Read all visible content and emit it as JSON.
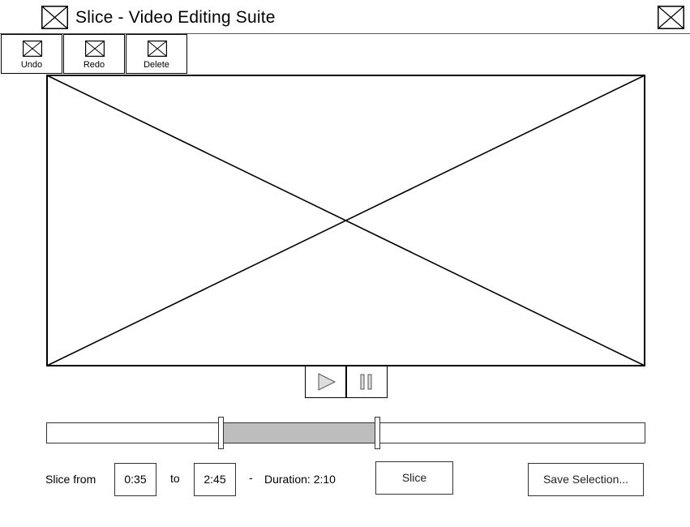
{
  "window": {
    "title": "Slice - Video Editing Suite",
    "app_icon": "placeholder-x-icon",
    "close_icon": "placeholder-x-icon"
  },
  "toolbar": {
    "undo_label": "Undo",
    "redo_label": "Redo",
    "delete_label": "Delete"
  },
  "player": {
    "video_placeholder": "image-placeholder",
    "play_icon": "play-icon",
    "pause_icon": "pause-icon"
  },
  "timeline": {
    "selection_start_fraction": 0.29,
    "selection_end_fraction": 0.55,
    "selection_color": "#bdbdbd"
  },
  "slice": {
    "from_label": "Slice from",
    "from_value": "0:35",
    "to_label": "to",
    "to_value": "2:45",
    "dash": "-",
    "duration_text": "Duration: 2:10",
    "slice_button": "Slice",
    "save_button": "Save Selection..."
  }
}
